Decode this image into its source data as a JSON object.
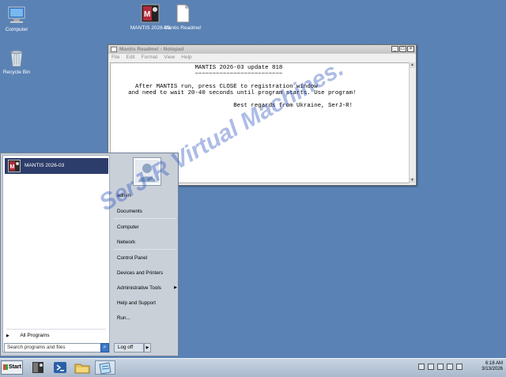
{
  "desktop": {
    "icons": [
      {
        "label": "Computer",
        "icon": "computer-icon"
      },
      {
        "label": "Recycle Bin",
        "icon": "recycle-bin-icon"
      },
      {
        "label": "MANTIS 2026-03",
        "icon": "mantis-icon"
      },
      {
        "label": "Mantis Readme!",
        "icon": "text-file-icon"
      }
    ],
    "watermark": "SerJ-R Virtual Machines."
  },
  "notepad": {
    "title": "Mantis Readme! - Notepad",
    "menu": [
      "File",
      "Edit",
      "Format",
      "View",
      "Help"
    ],
    "content": "                        MANTIS 2026-03 update 818\n                        ~~~~~~~~~~~~~~~~~~~~~~~~~\n\n       After MANTIS run, press CLOSE to registration window\n     and need to wait 20-40 seconds until program starts. Use program!\n\n                                   Best regards from Ukraine, SerJ-R!"
  },
  "start_menu": {
    "pinned": [
      {
        "label": "MANTIS 2026-03"
      }
    ],
    "all_programs": "All Programs",
    "search_placeholder": "Search programs and files",
    "right_items": [
      "admin",
      "Documents",
      "Computer",
      "Network",
      "Control Panel",
      "Devices and Printers",
      "Administrative Tools",
      "Help and Support",
      "Run..."
    ],
    "logoff": "Log off"
  },
  "taskbar": {
    "start": "Start",
    "apps": [
      "mantis-icon",
      "powershell-icon",
      "explorer-icon",
      "notepad-icon"
    ],
    "time": "6:18 AM",
    "date": "3/13/2026"
  }
}
